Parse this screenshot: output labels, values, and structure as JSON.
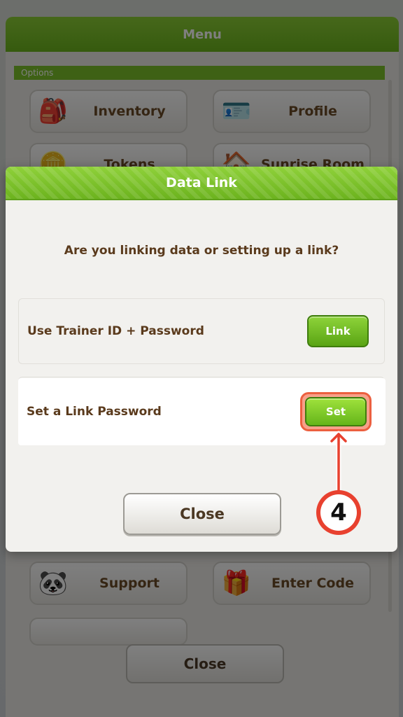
{
  "background_menu": {
    "title": "Menu",
    "section_label": "Options",
    "tiles": [
      {
        "label": "Inventory",
        "icon": "inventory-icon",
        "glyph": "🎒"
      },
      {
        "label": "Profile",
        "icon": "profile-icon",
        "glyph": "🪪"
      },
      {
        "label": "Tokens",
        "icon": "tokens-icon",
        "glyph": "🪙"
      },
      {
        "label": "Sunrise Room",
        "icon": "room-icon",
        "glyph": "🏠"
      },
      {
        "label": "Support",
        "icon": "support-icon",
        "glyph": "🐼"
      },
      {
        "label": "Enter Code",
        "icon": "enter-code-icon",
        "glyph": "🎁"
      }
    ],
    "close_label": "Close"
  },
  "dialog": {
    "title": "Data Link",
    "question": "Are you linking data or setting up a link?",
    "options": [
      {
        "label": "Use Trainer ID + Password",
        "button": "Link"
      },
      {
        "label": "Set a Link Password",
        "button": "Set"
      }
    ],
    "close_label": "Close"
  },
  "tutorial": {
    "step_number": "4"
  },
  "colors": {
    "header_green": "#7cc22a",
    "button_green": "#6cb31e",
    "highlight_ring": "#ec5f3f",
    "label_brown": "#5a3a1c",
    "step_red": "#e8412f"
  }
}
